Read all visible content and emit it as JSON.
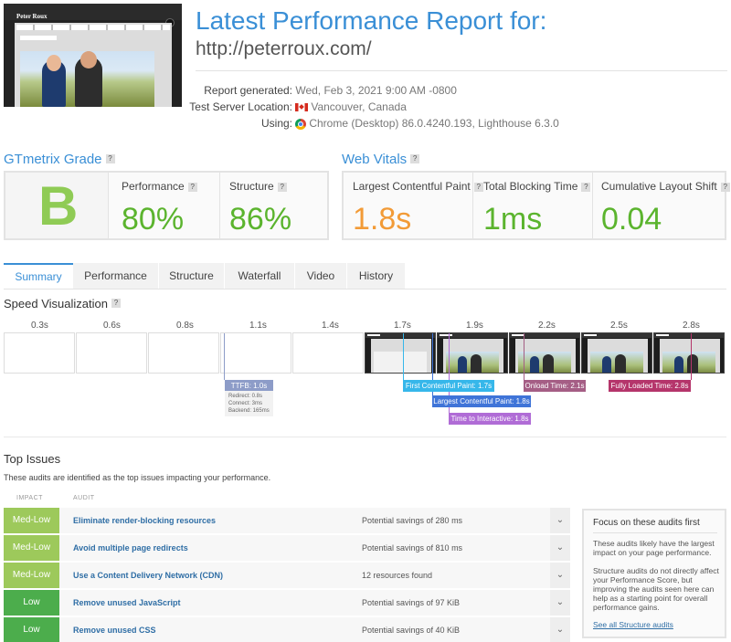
{
  "header": {
    "thumbnail_brand": "Peter Roux",
    "title": "Latest Performance Report for:",
    "url": "http://peterroux.com/",
    "report_generated_label": "Report generated:",
    "report_generated_value": "Wed, Feb 3, 2021 9:00 AM -0800",
    "server_label": "Test Server Location:",
    "server_value": "Vancouver, Canada",
    "using_label": "Using:",
    "using_value": "Chrome (Desktop) 86.0.4240.193, Lighthouse 6.3.0"
  },
  "grade": {
    "section_title": "GTmetrix Grade",
    "help": "?",
    "letter": "B",
    "performance_label": "Performance",
    "performance_value": "80%",
    "structure_label": "Structure",
    "structure_value": "86%"
  },
  "vitals": {
    "section_title": "Web Vitals",
    "help": "?",
    "lcp_label": "Largest Contentful Paint",
    "lcp_value": "1.8s",
    "tbt_label": "Total Blocking Time",
    "tbt_value": "1ms",
    "cls_label": "Cumulative Layout Shift",
    "cls_value": "0.04"
  },
  "tabs": [
    "Summary",
    "Performance",
    "Structure",
    "Waterfall",
    "Video",
    "History"
  ],
  "speed": {
    "title": "Speed Visualization",
    "help": "?",
    "times": [
      "0.3s",
      "0.6s",
      "0.8s",
      "1.1s",
      "1.4s",
      "1.7s",
      "1.9s",
      "2.2s",
      "2.5s",
      "2.8s"
    ],
    "markers": {
      "ttfb": "TTFB: 1.0s",
      "ttfb_redirect": "Redirect: 0.8s",
      "ttfb_connect": "Connect: 3ms",
      "ttfb_backend": "Backend: 165ms",
      "fcp": "First Contentful Paint: 1.7s",
      "lcp": "Largest Contentful Paint: 1.8s",
      "tti": "Time to Interactive: 1.8s",
      "onload": "Onload Time: 2.1s",
      "fully_loaded": "Fully Loaded Time: 2.8s"
    },
    "colors": {
      "ttfb": "#8d9cc8",
      "fcp": "#36b7ea",
      "lcp": "#3f74d8",
      "tti": "#b06cd6",
      "onload": "#a55e85",
      "fully_loaded": "#b5356b"
    }
  },
  "top_issues": {
    "title": "Top Issues",
    "subtitle": "These audits are identified as the top issues impacting your performance.",
    "col_impact": "IMPACT",
    "col_audit": "AUDIT",
    "rows": [
      {
        "impact": "Med-Low",
        "audit": "Eliminate render-blocking resources",
        "savings": "Potential savings of 280 ms"
      },
      {
        "impact": "Med-Low",
        "audit": "Avoid multiple page redirects",
        "savings": "Potential savings of 810 ms"
      },
      {
        "impact": "Med-Low",
        "audit": "Use a Content Delivery Network (CDN)",
        "savings": "12 resources found"
      },
      {
        "impact": "Low",
        "audit": "Remove unused JavaScript",
        "savings": "Potential savings of 97 KiB"
      },
      {
        "impact": "Low",
        "audit": "Remove unused CSS",
        "savings": "Potential savings of 40 KiB"
      }
    ]
  },
  "focus": {
    "title": "Focus on these audits first",
    "p1": "These audits likely have the largest impact on your page performance.",
    "p2": "Structure audits do not directly affect your Performance Score, but improving the audits seen here can help as a starting point for overall performance gains.",
    "link": "See all Structure audits"
  },
  "icons": {
    "flag": "canada-flag-icon",
    "browser": "chrome-icon",
    "expand": "chevron-down-icon",
    "help": "help-icon"
  }
}
